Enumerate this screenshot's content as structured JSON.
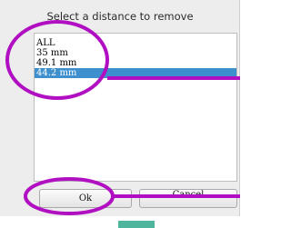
{
  "dialog": {
    "title": "Select a distance to remove",
    "list_items": [
      {
        "label": "ALL",
        "selected": false
      },
      {
        "label": "35 mm",
        "selected": false
      },
      {
        "label": "49.1 mm",
        "selected": false
      },
      {
        "label": "44.2 mm",
        "selected": true
      }
    ],
    "ok_label": "Ok",
    "cancel_label": "Cancel"
  },
  "colors": {
    "highlight": "#3d8fce",
    "annotation": "#b10fc2",
    "tab_accent": "#4fb59c"
  }
}
